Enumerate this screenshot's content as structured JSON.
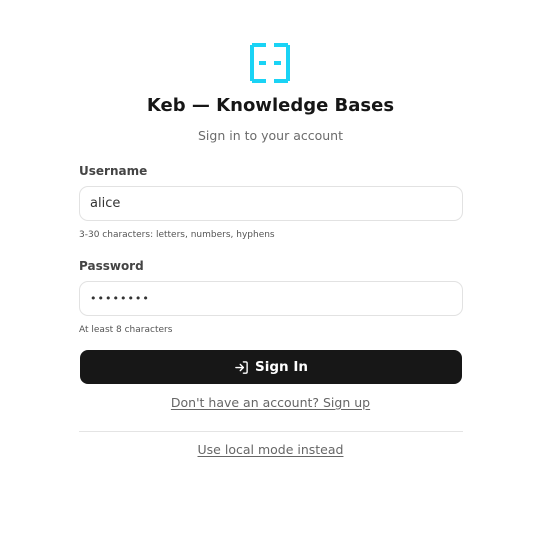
{
  "brand": {
    "title": "Keb — Knowledge Bases",
    "subtitle": "Sign in to your account",
    "logo_color": "#1ad3f5",
    "logo_icon": "keb-logo-icon"
  },
  "form": {
    "username": {
      "label": "Username",
      "value": "alice",
      "hint": "3-30 characters: letters, numbers, hyphens"
    },
    "password": {
      "label": "Password",
      "value": "••••••••",
      "hint": "At least 8 characters"
    },
    "submit": {
      "label": "Sign In",
      "icon": "sign-in-icon",
      "background": "#171717"
    }
  },
  "links": {
    "signup": "Don't have an account? Sign up",
    "local_mode": "Use local mode instead"
  }
}
